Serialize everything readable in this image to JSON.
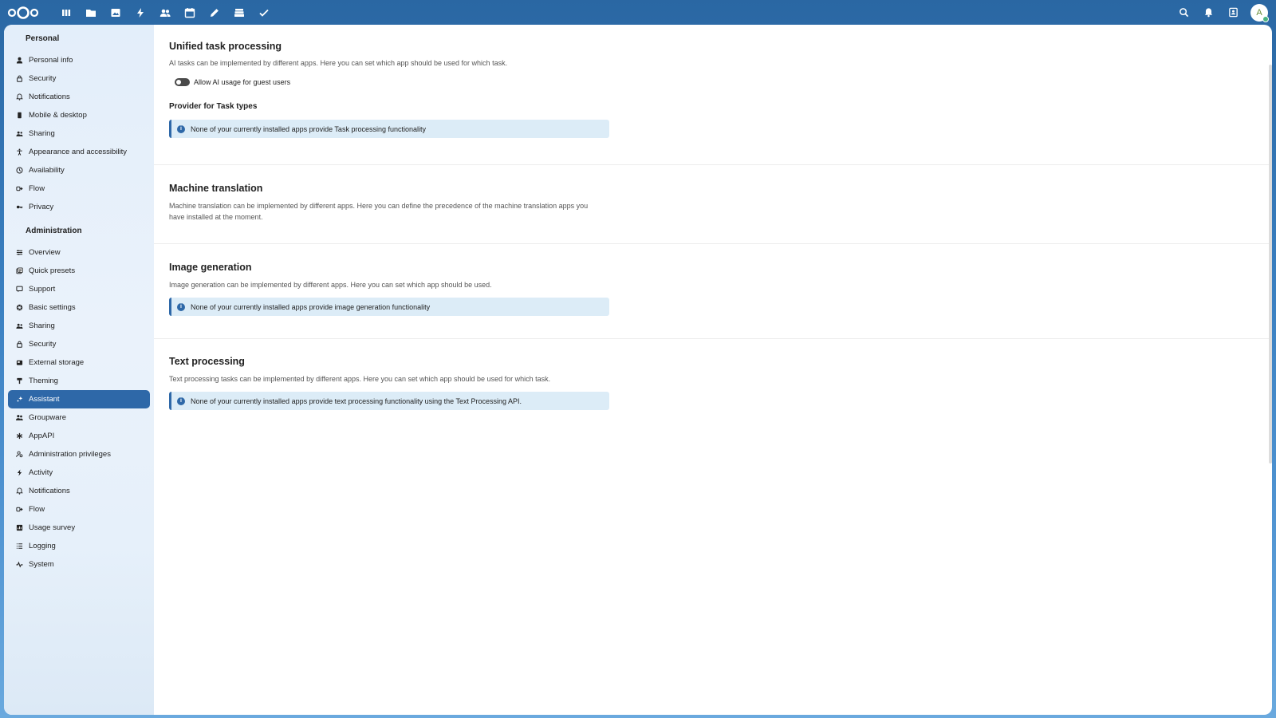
{
  "topbar": {
    "apps": [
      {
        "name": "dashboard-icon"
      },
      {
        "name": "files-icon"
      },
      {
        "name": "photos-icon"
      },
      {
        "name": "activity-icon"
      },
      {
        "name": "contacts-icon"
      },
      {
        "name": "calendar-icon"
      },
      {
        "name": "notes-icon"
      },
      {
        "name": "deck-icon"
      },
      {
        "name": "tasks-icon"
      }
    ],
    "avatar_letter": "A"
  },
  "sidebar": {
    "personal_title": "Personal",
    "personal_items": [
      {
        "label": "Personal info",
        "icon": "user-icon"
      },
      {
        "label": "Security",
        "icon": "lock-icon"
      },
      {
        "label": "Notifications",
        "icon": "bell-icon"
      },
      {
        "label": "Mobile & desktop",
        "icon": "phone-icon"
      },
      {
        "label": "Sharing",
        "icon": "share-icon"
      },
      {
        "label": "Appearance and accessibility",
        "icon": "accessibility-icon"
      },
      {
        "label": "Availability",
        "icon": "clock-icon"
      },
      {
        "label": "Flow",
        "icon": "flow-icon"
      },
      {
        "label": "Privacy",
        "icon": "key-icon"
      }
    ],
    "admin_title": "Administration",
    "admin_items": [
      {
        "label": "Overview",
        "icon": "overview-icon"
      },
      {
        "label": "Quick presets",
        "icon": "presets-icon"
      },
      {
        "label": "Support",
        "icon": "support-icon"
      },
      {
        "label": "Basic settings",
        "icon": "gear-icon"
      },
      {
        "label": "Sharing",
        "icon": "share-icon"
      },
      {
        "label": "Security",
        "icon": "lock-icon"
      },
      {
        "label": "External storage",
        "icon": "storage-icon"
      },
      {
        "label": "Theming",
        "icon": "brush-icon"
      },
      {
        "label": "Assistant",
        "icon": "sparkle-icon",
        "active": true
      },
      {
        "label": "Groupware",
        "icon": "group-icon"
      },
      {
        "label": "AppAPI",
        "icon": "appapi-icon"
      },
      {
        "label": "Administration privileges",
        "icon": "admin-icon"
      },
      {
        "label": "Activity",
        "icon": "activity-icon"
      },
      {
        "label": "Notifications",
        "icon": "bell-icon"
      },
      {
        "label": "Flow",
        "icon": "flow-icon"
      },
      {
        "label": "Usage survey",
        "icon": "survey-icon"
      },
      {
        "label": "Logging",
        "icon": "list-icon"
      },
      {
        "label": "System",
        "icon": "pulse-icon"
      }
    ]
  },
  "sections": {
    "unified": {
      "title": "Unified task processing",
      "desc": "AI tasks can be implemented by different apps. Here you can set which app should be used for which task.",
      "toggle_label": "Allow AI usage for guest users",
      "toggle_on": false,
      "provider_title": "Provider for Task types",
      "note": "None of your currently installed apps provide Task processing functionality"
    },
    "translation": {
      "title": "Machine translation",
      "desc": "Machine translation can be implemented by different apps. Here you can define the precedence of the machine translation apps you have installed at the moment."
    },
    "image": {
      "title": "Image generation",
      "desc": "Image generation can be implemented by different apps. Here you can set which app should be used.",
      "note": "None of your currently installed apps provide image generation functionality"
    },
    "text": {
      "title": "Text processing",
      "desc": "Text processing tasks can be implemented by different apps. Here you can set which app should be used for which task.",
      "note": "None of your currently installed apps provide text processing functionality using the Text Processing API."
    }
  },
  "colors": {
    "accent": "#2e68a8",
    "note_bg": "#dcecf7"
  }
}
